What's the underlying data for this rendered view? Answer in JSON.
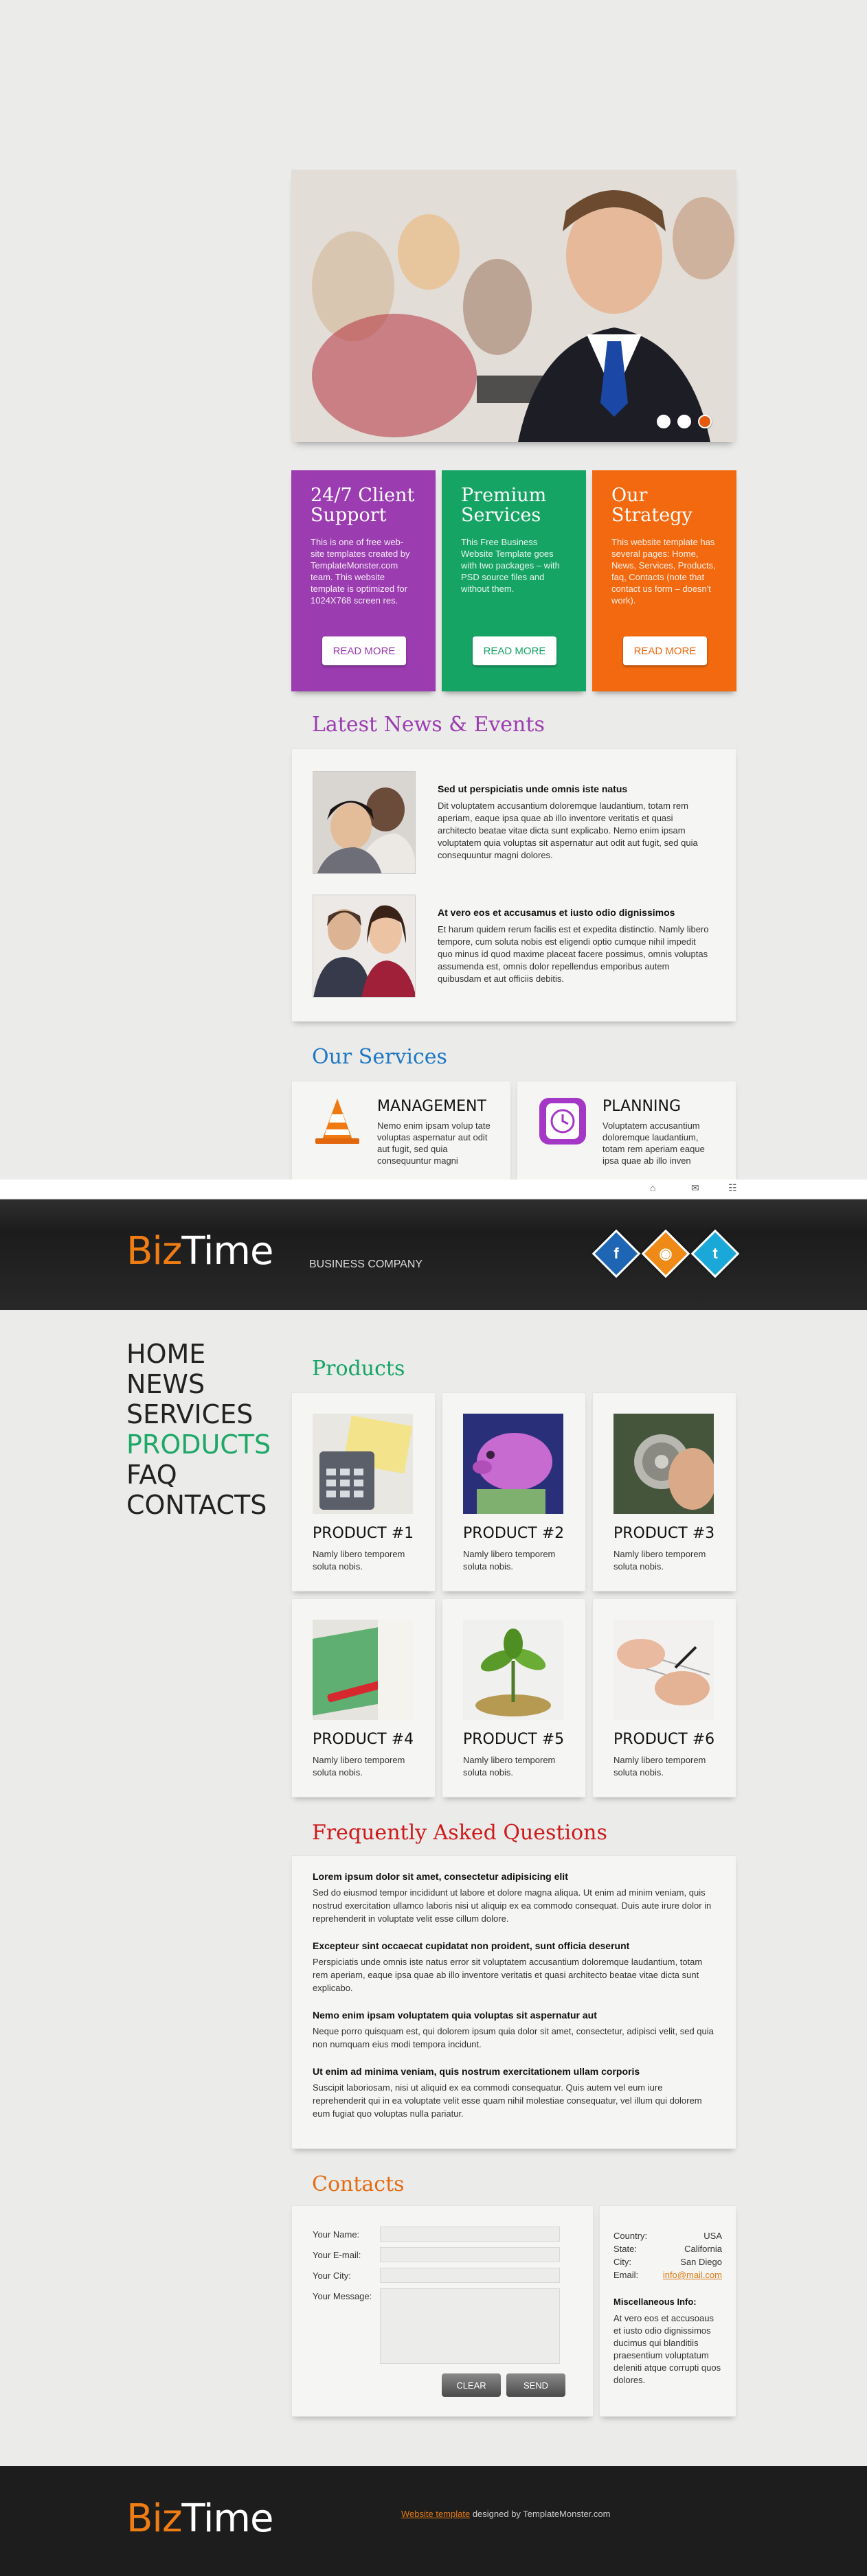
{
  "hero": {
    "slides": 3,
    "active_slide": 3,
    "accent": "#e45a10"
  },
  "features": [
    {
      "title": "24/7 Client Support",
      "text": "This is one of free web-site templates created by TemplateMonster.com team. This website template is optimized for 1024X768 screen res.",
      "button": "READ MORE",
      "color": "#9b3cb0"
    },
    {
      "title": "Premium Services",
      "text": "This Free Business Website Template goes with two packages – with PSD source files and without them.",
      "button": "READ MORE",
      "color": "#16a465"
    },
    {
      "title": "Our Strategy",
      "text": "This website template has several pages: Home, News, Services, Products, faq, Contacts (note that contact us form – doesn't work).",
      "button": "READ MORE",
      "color": "#f3690f"
    }
  ],
  "news": {
    "title": "Latest News & Events",
    "items": [
      {
        "heading": "Sed ut perspiciatis unde omnis iste natus",
        "text": "Dit voluptatem accusantium doloremque laudantium, totam rem aperiam, eaque ipsa quae ab illo inventore veritatis et quasi architecto beatae vitae dicta sunt explicabo. Nemo enim ipsam voluptatem quia voluptas sit aspernatur aut odit aut fugit, sed quia consequuntur magni dolores."
      },
      {
        "heading": "At vero eos et accusamus et iusto odio dignissimos",
        "text": "Et harum quidem rerum facilis est et expedita distinctio. Namly libero tempore, cum soluta nobis est eligendi optio cumque nihil impedit quo minus id quod maxime placeat facere possimus, omnis voluptas assumenda est, omnis dolor repellendus emporibus autem quibusdam et aut officiis debitis."
      }
    ]
  },
  "services": {
    "title": "Our Services",
    "items": [
      {
        "name": "MANAGEMENT",
        "text": "Nemo enim ipsam volup tate voluptas aspernatur aut odit aut fugit, sed quia consequuntur magni"
      },
      {
        "name": "PLANNING",
        "text": "Voluptatem accusantium doloremque laudantium, totam rem aperiam eaque ipsa quae ab illo inven"
      }
    ]
  },
  "header": {
    "logo_biz": "Biz",
    "logo_time": "Time",
    "tagline": "BUSINESS COMPANY",
    "social": [
      {
        "icon": "facebook-icon",
        "glyph": "f",
        "color": "#1e66b3"
      },
      {
        "icon": "rss-icon",
        "glyph": "◉",
        "color": "#ef8a17"
      },
      {
        "icon": "twitter-icon",
        "glyph": "t",
        "color": "#1aa8d8"
      }
    ]
  },
  "nav": [
    "HOME",
    "NEWS",
    "SERVICES",
    "PRODUCTS",
    "FAQ",
    "CONTACTS"
  ],
  "nav_active": "PRODUCTS",
  "products": {
    "title": "Products",
    "items": [
      {
        "name": "PRODUCT #1",
        "text": "Namly libero temporem soluta nobis."
      },
      {
        "name": "PRODUCT #2",
        "text": "Namly libero temporem soluta nobis."
      },
      {
        "name": "PRODUCT #3",
        "text": "Namly libero temporem soluta nobis."
      },
      {
        "name": "PRODUCT #4",
        "text": "Namly libero temporem soluta nobis."
      },
      {
        "name": "PRODUCT #5",
        "text": "Namly libero temporem soluta nobis."
      },
      {
        "name": "PRODUCT #6",
        "text": "Namly libero temporem soluta nobis."
      }
    ]
  },
  "faq": {
    "title": "Frequently Asked Questions",
    "items": [
      {
        "q": "Lorem ipsum dolor sit amet, consectetur adipisicing elit",
        "a": "Sed do eiusmod tempor incididunt ut labore et dolore magna aliqua. Ut enim ad minim veniam, quis nostrud exercitation ullamco laboris nisi ut aliquip ex ea commodo consequat. Duis aute irure dolor in reprehenderit in voluptate velit esse cillum dolore."
      },
      {
        "q": "Excepteur sint occaecat cupidatat non proident, sunt officia deserunt",
        "a": "Perspiciatis unde omnis iste natus error sit voluptatem accusantium doloremque laudantium, totam rem aperiam, eaque ipsa quae ab illo inventore veritatis et quasi architecto beatae vitae dicta sunt explicabo."
      },
      {
        "q": "Nemo enim ipsam voluptatem quia voluptas sit aspernatur aut",
        "a": "Neque porro quisquam est, qui dolorem ipsum quia dolor sit amet, consectetur, adipisci velit, sed quia non numquam eius modi tempora incidunt."
      },
      {
        "q": "Ut enim ad minima veniam, quis nostrum exercitationem ullam corporis",
        "a": "Suscipit laboriosam, nisi ut aliquid ex ea commodi consequatur. Quis autem vel eum iure reprehenderit qui in ea voluptate velit esse quam nihil molestiae consequatur, vel illum qui dolorem eum fugiat quo voluptas nulla pariatur."
      }
    ]
  },
  "contacts": {
    "title": "Contacts",
    "labels": {
      "name": "Your Name:",
      "email": "Your E-mail:",
      "city": "Your City:",
      "message": "Your Message:"
    },
    "clear": "CLEAR",
    "send": "SEND",
    "info": [
      {
        "label": "Country:",
        "value": "USA"
      },
      {
        "label": "State:",
        "value": "California"
      },
      {
        "label": "City:",
        "value": "San Diego"
      },
      {
        "label": "Email:",
        "value": "info@mail.com"
      }
    ],
    "misc_title": "Miscellaneous Info:",
    "misc_text": "At vero eos et accusoaus et iusto odio dignissimos ducimus qui blanditiis praesentium voluptatum deleniti atque corrupti quos dolores."
  },
  "footer": {
    "logo_biz": "Biz",
    "logo_time": "Time",
    "link": "Website template",
    "credit": " designed by TemplateMonster.com"
  },
  "colors": {
    "purple": "#9b3cb0",
    "green": "#16a465",
    "orange": "#f3690f",
    "blue": "#1e77c4",
    "red": "#d01a1a",
    "link": "#e07a12"
  }
}
